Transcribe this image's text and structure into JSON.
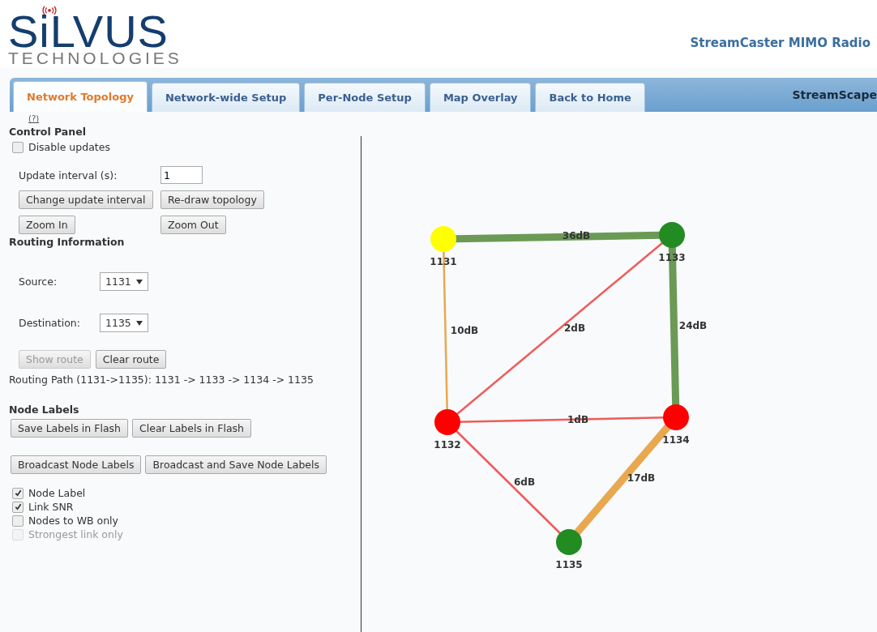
{
  "header": {
    "brand": "SiLVUS",
    "brand_sub": "TECHNOLOGIES",
    "product": "StreamCaster MIMO Radio"
  },
  "tabs": [
    {
      "label": "Network Topology",
      "selected": true
    },
    {
      "label": "Network-wide Setup",
      "selected": false
    },
    {
      "label": "Per-Node Setup",
      "selected": false
    },
    {
      "label": "Map Overlay",
      "selected": false
    },
    {
      "label": "Back to Home",
      "selected": false
    }
  ],
  "tabbar_title": "StreamScape",
  "help_link": "(?)",
  "control_panel": {
    "title": "Control Panel",
    "disable_updates": {
      "label": "Disable updates",
      "checked": false
    },
    "interval_label": "Update interval (s):",
    "interval_value": "1",
    "buttons": [
      {
        "label": "Change update interval",
        "disabled": false
      },
      {
        "label": "Re-draw topology",
        "disabled": false
      },
      {
        "label": "Zoom In",
        "disabled": false
      },
      {
        "label": "Zoom Out",
        "disabled": false
      }
    ]
  },
  "routing": {
    "title": "Routing Information",
    "source_label": "Source:",
    "source_value": "1131",
    "destination_label": "Destination:",
    "destination_value": "1135",
    "buttons": [
      {
        "label": "Show route",
        "disabled": true
      },
      {
        "label": "Clear route",
        "disabled": false
      }
    ],
    "path": "Routing Path (1131->1135): 1131 -> 1133 -> 1134 -> 1135"
  },
  "node_labels": {
    "title": "Node Labels",
    "buttons": [
      {
        "label": "Save Labels in Flash",
        "disabled": false
      },
      {
        "label": "Clear Labels in Flash",
        "disabled": false
      },
      {
        "label": "Broadcast Node Labels",
        "disabled": false
      },
      {
        "label": "Broadcast and Save Node Labels",
        "disabled": false
      }
    ]
  },
  "options": [
    {
      "label": "Node Label",
      "checked": true,
      "disabled": false
    },
    {
      "label": "Link SNR",
      "checked": true,
      "disabled": false
    },
    {
      "label": "Nodes to WB only",
      "checked": false,
      "disabled": false
    },
    {
      "label": "Strongest link only",
      "checked": false,
      "disabled": true
    }
  ],
  "topology": {
    "nodes": [
      {
        "label": "1131",
        "color": "#ffff00"
      },
      {
        "label": "1133",
        "color": "#228b22"
      },
      {
        "label": "1132",
        "color": "#ff0000"
      },
      {
        "label": "1134",
        "color": "#ff0000"
      },
      {
        "label": "1135",
        "color": "#228b22"
      }
    ],
    "links": [
      {
        "label": "36dB",
        "color": "#6a9a55",
        "kind": "thick"
      },
      {
        "label": "10dB",
        "color": "#e8a850",
        "kind": "thin"
      },
      {
        "label": "2dB",
        "color": "#f05a5a",
        "kind": "thin"
      },
      {
        "label": "24dB",
        "color": "#6a9a55",
        "kind": "thick"
      },
      {
        "label": "1dB",
        "color": "#f05a5a",
        "kind": "thin"
      },
      {
        "label": "6dB",
        "color": "#f05a5a",
        "kind": "thin"
      },
      {
        "label": "17dB",
        "color": "#e8a850",
        "kind": "thick"
      }
    ]
  }
}
